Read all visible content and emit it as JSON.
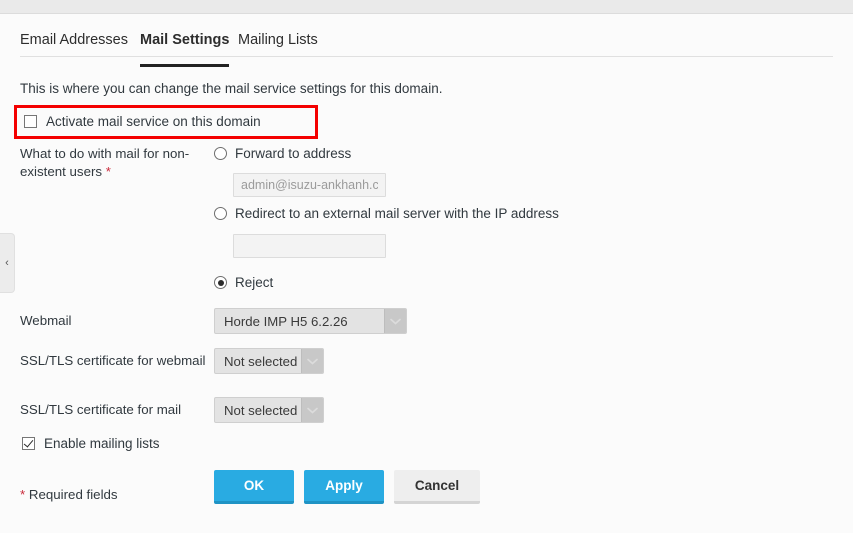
{
  "window": {
    "background_color": "#fbfbfb",
    "top_strip_color": "#eaeaea"
  },
  "tabs": [
    {
      "label": "Email Addresses",
      "active": false
    },
    {
      "label": "Mail Settings",
      "active": true
    },
    {
      "label": "Mailing Lists",
      "active": false
    }
  ],
  "intro": {
    "text": "This is where you can change the mail service settings for this domain."
  },
  "annotation": {
    "type": "highlight-rectangle",
    "color": "#f40000",
    "target": "activate-mail-service-checkbox"
  },
  "activate": {
    "label": "Activate mail service on this domain",
    "checked": false
  },
  "sidebar_handle": {
    "icon": "chevron-left-icon",
    "glyph": "‹"
  },
  "form": {
    "nonexistent_users": {
      "label": "What to do with mail for non-existent users",
      "required_marker": "*",
      "options": [
        {
          "label": "Forward to address",
          "selected": false
        },
        {
          "label": "Redirect to an external mail server with the IP address",
          "selected": false
        },
        {
          "label": "Reject",
          "selected": true
        }
      ],
      "forward_address": {
        "value": "",
        "placeholder": "admin@isuzu-ankhanh.com"
      },
      "redirect_ip": {
        "value": "",
        "placeholder": ""
      }
    },
    "webmail": {
      "label": "Webmail",
      "value": "Horde IMP H5 6.2.26"
    },
    "ssl_webmail": {
      "label": "SSL/TLS certificate for webmail",
      "value": "Not selected"
    },
    "ssl_mail": {
      "label": "SSL/TLS certificate for mail",
      "value": "Not selected"
    },
    "mailing_lists": {
      "label": "Enable mailing lists",
      "checked": true
    }
  },
  "footer": {
    "required_note_star": "*",
    "required_note_text": " Required fields",
    "buttons": {
      "ok": "OK",
      "apply": "Apply",
      "cancel": "Cancel"
    },
    "primary_color": "#29abe2"
  }
}
